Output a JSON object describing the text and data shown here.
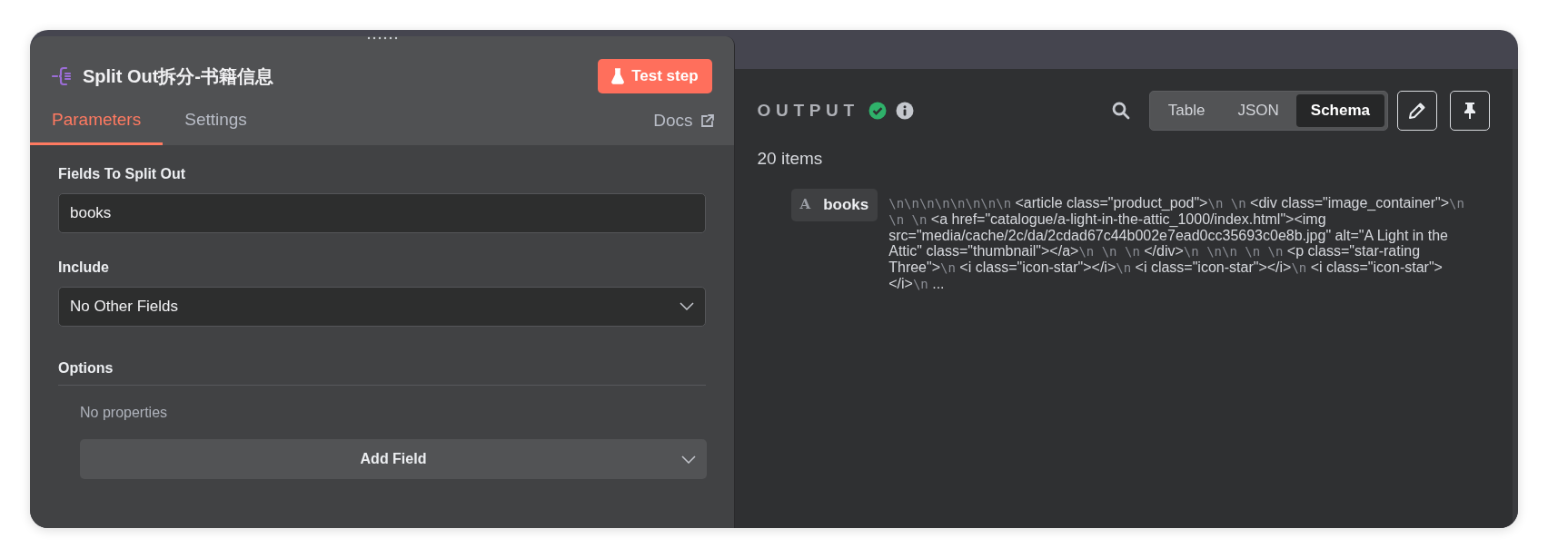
{
  "node": {
    "title": "Split Out拆分-书籍信息",
    "test_button": "Test step"
  },
  "tabs": [
    {
      "label": "Parameters",
      "selected": true
    },
    {
      "label": "Settings",
      "selected": false
    }
  ],
  "docs_link": "Docs",
  "parameters": [
    {
      "kind": "text",
      "label": "Fields To Split Out",
      "value": "books"
    },
    {
      "kind": "select",
      "label": "Include",
      "value": "No Other Fields"
    }
  ],
  "options": {
    "label": "Options",
    "empty_text": "No properties",
    "add_button": "Add Field"
  },
  "output": {
    "title": "OUTPUT",
    "success": true,
    "views": [
      {
        "label": "Table",
        "selected": false
      },
      {
        "label": "JSON",
        "selected": false
      },
      {
        "label": "Schema",
        "selected": true
      }
    ],
    "count": "20 items",
    "fields": [
      {
        "name": "books",
        "type_icon": "A",
        "value_parts": [
          {
            "kind": "escape",
            "text": "\\n\\n\\n\\n\\n\\n\\n\\n"
          },
          {
            "kind": "text",
            "text": " <article class=\"product_pod\">"
          },
          {
            "kind": "escape",
            "text": "\\n \\n"
          },
          {
            "kind": "text",
            "text": " <div class=\"image_container\">"
          },
          {
            "kind": "escape",
            "text": "\\n \\n \\n"
          },
          {
            "kind": "text",
            "text": " <a href=\"catalogue/a-light-in-the-attic_1000/index.html\"><img src=\"media/cache/2c/da/2cdad67c44b002e7ead0cc35693c0e8b.jpg\" alt=\"A Light in the Attic\" class=\"thumbnail\"></a>"
          },
          {
            "kind": "escape",
            "text": "\\n \\n \\n"
          },
          {
            "kind": "text",
            "text": " </div>"
          },
          {
            "kind": "escape",
            "text": "\\n \\n\\n \\n \\n"
          },
          {
            "kind": "text",
            "text": " <p class=\"star-rating Three\">"
          },
          {
            "kind": "escape",
            "text": "\\n"
          },
          {
            "kind": "text",
            "text": " <i class=\"icon-star\"></i>"
          },
          {
            "kind": "escape",
            "text": "\\n"
          },
          {
            "kind": "text",
            "text": " <i class=\"icon-star\"></i>"
          },
          {
            "kind": "escape",
            "text": "\\n"
          },
          {
            "kind": "text",
            "text": " <i class=\"icon-star\"></i>"
          },
          {
            "kind": "escape",
            "text": "\\n"
          },
          {
            "kind": "text",
            "text": " ..."
          }
        ]
      }
    ]
  }
}
